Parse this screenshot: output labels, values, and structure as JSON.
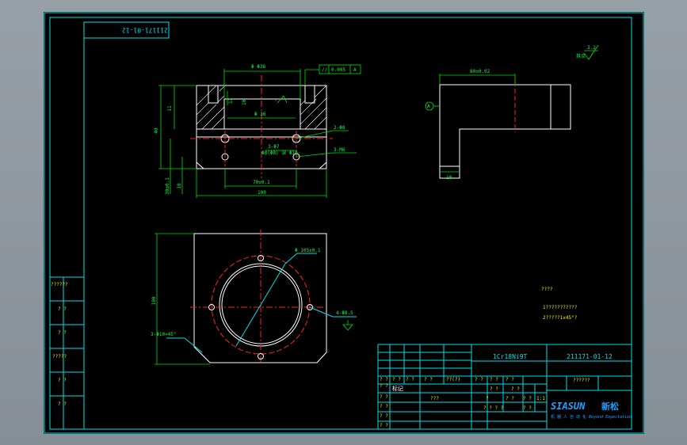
{
  "drawing": {
    "corner_code": "211171-01-12",
    "material": "1Cr18Ni9T",
    "drawing_number": "211171-01-12",
    "title_cell": "??????",
    "notes_title": "????",
    "note_1": "1???????????",
    "note_2": "2?????1x45°?",
    "roughness_symbol": "其余",
    "roughness_value": "3.2"
  },
  "dimensions": {
    "top_width": "Φ Φ36",
    "tolerance_box_symbol": "//",
    "tolerance_box_value": "0.005",
    "tolerance_box_datum": "A",
    "height_total": "40",
    "height_upper": "11",
    "slot_depth": "12",
    "bore_dim": "Φ 36",
    "hole_note_1": "2-Φ8",
    "hole_note_2": "3-Φ7",
    "hole_note_3": "Φ8(Φ8) 深 Φ10",
    "hole_note_4": "3-M6",
    "bottom_dim": "70±0.1",
    "base_width": "100",
    "side_dim_1": "30±0.1",
    "side_dim_2": "10",
    "right_view_width": "80±0.02",
    "right_view_small": "10",
    "datum_label": "A",
    "circle_dim": "Φ 105±0.1",
    "left_height": "100",
    "chamfer_note": "3-Φ10×45°",
    "bolt_note": "4-Φ8.5"
  },
  "left_table": {
    "rows": [
      "??????",
      "? ?",
      "? ?",
      "?????",
      "? ?",
      "? ?"
    ]
  },
  "title_block": {
    "row_marks": [
      "? ?",
      "? ?",
      "? ?",
      "? ?",
      "? ?"
    ],
    "header_cells": [
      "? ?",
      "? ?",
      "? ?",
      "? ?",
      "??(?)",
      "? ?",
      "? ?",
      "? ?"
    ],
    "cell_tag": "标记",
    "scale_cells": [
      "? ?",
      "? ?"
    ],
    "row3_cells": [
      "???",
      "?",
      "? ?",
      "? ?",
      "1:1"
    ],
    "row4_cells": [
      "? ? ? ?",
      "? ?"
    ],
    "company_name": "SIASUN",
    "company_cn": "新松",
    "company_sub": "机 器 人 自 动 化",
    "company_sub_en": "Beyond Expectation"
  },
  "colors": {
    "outline": "#00e0e8",
    "part": "#ffffff",
    "centerline": "#ff2020",
    "dimension": "#00e000",
    "sheet": "#000000"
  }
}
